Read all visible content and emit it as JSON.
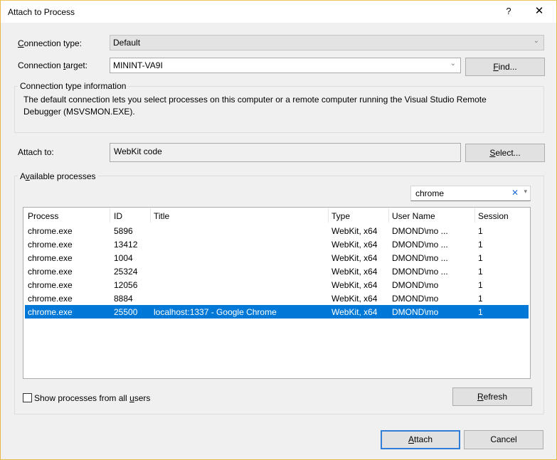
{
  "window": {
    "title": "Attach to Process",
    "help_label": "?",
    "close_label": "✕"
  },
  "connection": {
    "type_label_prefix": "",
    "type_label_mnemonic": "C",
    "type_label_rest": "onnection type:",
    "type_value": "Default",
    "target_label_prefix": "Connection ",
    "target_label_mnemonic": "t",
    "target_label_rest": "arget:",
    "target_value": "MININT-VA9I",
    "find_button_mnemonic": "F",
    "find_button_rest": "ind...",
    "chevron_icon": "⌄"
  },
  "info": {
    "legend": "Connection type information",
    "line1": "The default connection lets you select processes on this computer or a remote computer running the Visual Studio Remote",
    "line2": "Debugger (MSVSMON.EXE)."
  },
  "attach_to": {
    "label": "Attach to:",
    "value": "WebKit code",
    "select_button_mnemonic": "S",
    "select_button_rest": "elect..."
  },
  "processes": {
    "legend_prefix": "A",
    "legend_mnemonic": "v",
    "legend_rest": "ailable processes",
    "search_value": "chrome",
    "search_clear_icon": "✕",
    "search_dropdown_icon": "▾",
    "columns": [
      "Process",
      "ID",
      "Title",
      "Type",
      "User Name",
      "Session"
    ],
    "rows": [
      {
        "process": "chrome.exe",
        "id": "5896",
        "title": "",
        "type": "WebKit, x64",
        "user": "DMOND\\mo ...",
        "session": "1"
      },
      {
        "process": "chrome.exe",
        "id": "13412",
        "title": "",
        "type": "WebKit, x64",
        "user": "DMOND\\mo ...",
        "session": "1"
      },
      {
        "process": "chrome.exe",
        "id": "1004",
        "title": "",
        "type": "WebKit, x64",
        "user": "DMOND\\mo ...",
        "session": "1"
      },
      {
        "process": "chrome.exe",
        "id": "25324",
        "title": "",
        "type": "WebKit, x64",
        "user": "DMOND\\mo ...",
        "session": "1"
      },
      {
        "process": "chrome.exe",
        "id": "12056",
        "title": "",
        "type": "WebKit, x64",
        "user": "DMOND\\mo",
        "session": "1"
      },
      {
        "process": "chrome.exe",
        "id": "8884",
        "title": "",
        "type": "WebKit, x64",
        "user": "DMOND\\mo",
        "session": "1"
      },
      {
        "process": "chrome.exe",
        "id": "25500",
        "title": "localhost:1337 - Google Chrome",
        "type": "WebKit, x64",
        "user": "DMOND\\mo",
        "session": "1",
        "selected": true
      }
    ],
    "show_all_prefix": "Show processes from all ",
    "show_all_mnemonic": "u",
    "show_all_rest": "sers",
    "show_all_checked": false,
    "refresh_mnemonic": "R",
    "refresh_rest": "efresh"
  },
  "footer": {
    "attach_mnemonic": "A",
    "attach_rest": "ttach",
    "cancel_label": "Cancel"
  },
  "colors": {
    "selection": "#0078d7",
    "window_border": "#e8b84a",
    "default_button_border": "#2f7ed8"
  }
}
